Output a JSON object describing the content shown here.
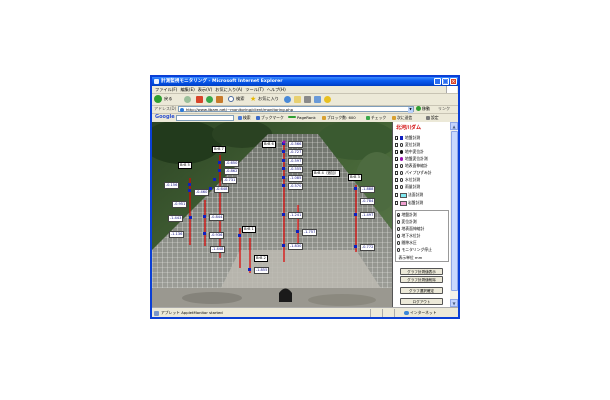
{
  "window": {
    "title": "計測監視モニタリング - Microsoft Internet Explorer",
    "minimize": "_",
    "maximize": "□",
    "close": "×"
  },
  "menu": [
    "ファイル(F)",
    "編集(E)",
    "表示(V)",
    "お気に入り(A)",
    "ツール(T)",
    "ヘルプ(H)"
  ],
  "toolbar": {
    "back": "戻る",
    "search": "検索",
    "favorites": "お気に入り"
  },
  "address": {
    "label": "アドレス(D)",
    "url": "http://www.libam.net/~monitoring/client/monitoring.php",
    "go": "移動",
    "links": "リンク"
  },
  "google": {
    "logo": "Google",
    "search": "検索",
    "bookmark": "ブックマーク",
    "pagerank": "PageRank",
    "blocked": "ブロック数: 600",
    "check": "チェック",
    "send": "次に送信",
    "settings": "設定"
  },
  "site": {
    "title": "北河川ダム",
    "layers": [
      {
        "label": "地盤計測",
        "checked": true,
        "marker": "square-blue"
      },
      {
        "label": "変位計測",
        "checked": false,
        "marker": "circle-hollow"
      },
      {
        "label": "地中変位計",
        "checked": true,
        "marker": "dot-black"
      },
      {
        "label": "地盤変位計測",
        "checked": true,
        "marker": "dot-purple"
      },
      {
        "label": "地表面伸縮計",
        "checked": false,
        "marker": "circle-hollow"
      },
      {
        "label": "パイプひずみ計",
        "checked": false,
        "marker": "circle-hollow"
      },
      {
        "label": "水位計測",
        "checked": false,
        "marker": "circle-hollow"
      },
      {
        "label": "雨量計測",
        "checked": false,
        "marker": "circle-hollow"
      },
      {
        "label": "法面計測",
        "checked": false,
        "marker": "box-cyan"
      },
      {
        "label": "岩盤計測",
        "checked": false,
        "marker": "box-pink"
      }
    ],
    "modes": [
      {
        "label": "地盤計測",
        "selected": true
      },
      {
        "label": "変位計測",
        "selected": false
      },
      {
        "label": "地表面伸縮計",
        "selected": false
      },
      {
        "label": "地下水位計",
        "selected": false
      },
      {
        "label": "間隙水圧",
        "selected": false
      },
      {
        "label": "モニタリング停止",
        "selected": false
      }
    ],
    "unit": "表示単位 mm",
    "buttons": {
      "show": "グラフ計測値表示",
      "clear": "グラフ計測値削除",
      "confirm": "グラフ選択確定",
      "logout": "ログアウト"
    }
  },
  "labels": [
    "BrB 6",
    "BrB 7",
    "BrB 5",
    "BrB 4（追加）",
    "BrB 3",
    "BrB 1",
    "BrB 2"
  ],
  "points": [
    "-0.566",
    "-0.727",
    "-0.597",
    "-0.555",
    "-1.085",
    "-0.570",
    "-0.650",
    "-0.862",
    "-0.731",
    "-0.648",
    "-0.156",
    "-0.460",
    "-0.951",
    "-1.443",
    "-0.844",
    "-0.936",
    "-1.136",
    "-1.448",
    "-1.830",
    "-1.241",
    "-1.757",
    "-1.888",
    "-0.784",
    "-1.497",
    "-0.772",
    "-1.855"
  ],
  "status": {
    "text": "アプレット AppletMonitor started",
    "zone": "インターネット"
  },
  "colors": {
    "titlebar": "#0a5cf0",
    "vector_line": "#e00000",
    "point_marker": "#1020c0",
    "panel_title": "#d00000",
    "legend_cyan": "#7fe8f0",
    "legend_pink": "#f0a0d0"
  },
  "icons": [
    "ie-icon",
    "back-icon",
    "forward-icon",
    "stop-icon",
    "refresh-icon",
    "home-icon",
    "search-icon",
    "favorites-star-icon",
    "history-icon",
    "mail-icon",
    "print-icon",
    "go-arrow-icon",
    "globe-icon"
  ]
}
